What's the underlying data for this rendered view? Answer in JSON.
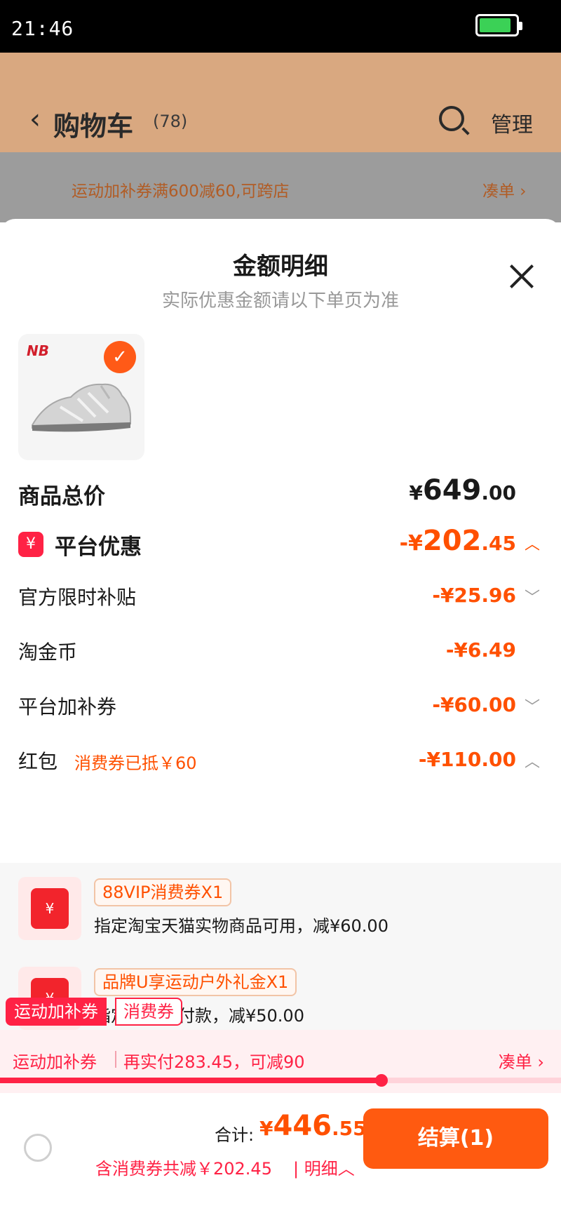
{
  "status": {
    "time": "21:46"
  },
  "background": {
    "back_glyph": "‹",
    "title": "购物车",
    "count": "(78)",
    "manage": "管理",
    "promo": "运动加补券满600减60,可跨店",
    "cou": "凑单 ›"
  },
  "sheet": {
    "title": "金额明细",
    "subtitle": "实际优惠金额请以下单页为准",
    "product": {
      "brand_logo": "NB",
      "check_glyph": "✓"
    }
  },
  "rows": {
    "total": {
      "label": "商品总价",
      "currency": "¥",
      "int": "649",
      "dec": ".00"
    },
    "platform": {
      "label": "平台优惠",
      "icon": "¥",
      "sign": "-¥",
      "int": "202",
      "dec": ".45",
      "chev": "︿"
    },
    "subsidy": {
      "label": "官方限时补贴",
      "amount": "-¥25.96",
      "chev": "﹀"
    },
    "coins": {
      "label": "淘金币",
      "amount": "-¥6.49"
    },
    "platform_coupon": {
      "label": "平台加补券",
      "amount": "-¥60.00",
      "chev": "﹀"
    },
    "redpacket": {
      "label": "红包",
      "note": "消费券已抵￥60",
      "amount": "-¥110.00",
      "chev": "︿"
    }
  },
  "redpackets": [
    {
      "icon": "¥",
      "tag": "88VIP消费券X1",
      "desc": "指定淘宝天猫实物商品可用，减¥60.00"
    },
    {
      "icon": "¥",
      "tag": "品牌U享运动户外礼金X1",
      "desc": "指定商品的付款，减¥50.00"
    }
  ],
  "badges": {
    "red": "运动加补券",
    "white": "消费券"
  },
  "coupon_bar": {
    "label": "运动加补券",
    "text": "再实付283.45，可减90",
    "link": "凑单 ›",
    "progress": 0.68
  },
  "footer": {
    "total_label": "合计:",
    "currency": "¥",
    "int": "446",
    "dec": ".55",
    "note": "含消费券共减￥202.45",
    "detail": "| 明细︿",
    "checkout": "结算(1)"
  },
  "colors": {
    "accent": "#ff5000",
    "red": "#ff2245",
    "checkout": "#ff5a10"
  }
}
